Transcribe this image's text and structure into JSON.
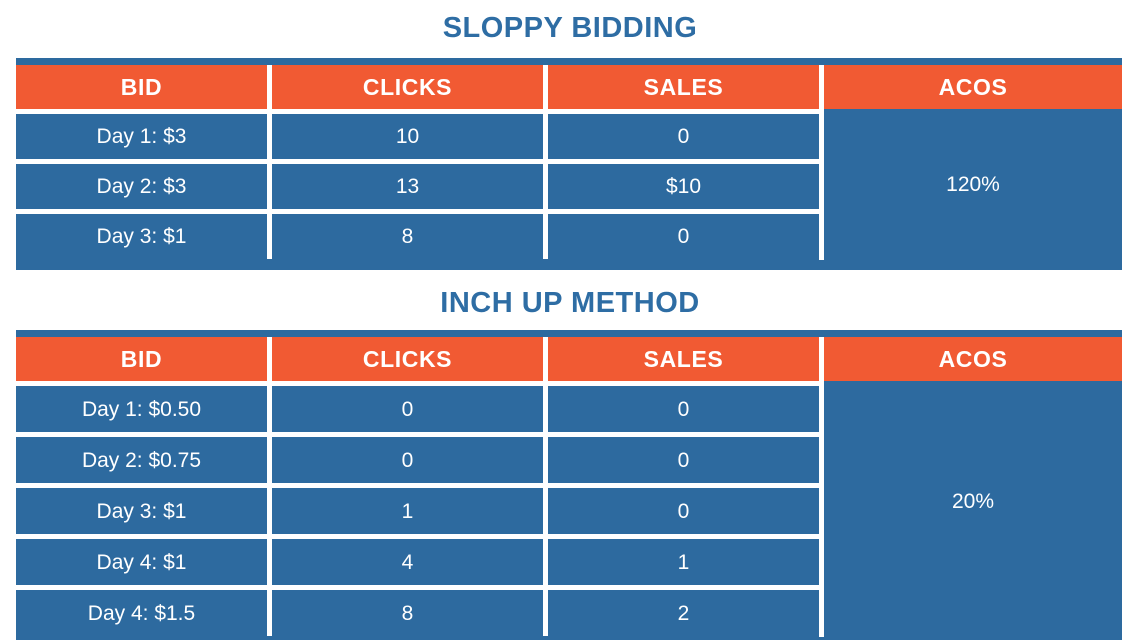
{
  "tables": [
    {
      "title": "SLOPPY BIDDING",
      "columns": [
        "BID",
        "CLICKS",
        "SALES",
        "ACOS"
      ],
      "rows": [
        {
          "bid": "Day 1: $3",
          "clicks": "10",
          "sales": "0"
        },
        {
          "bid": "Day 2: $3",
          "clicks": "13",
          "sales": "$10"
        },
        {
          "bid": "Day 3: $1",
          "clicks": "8",
          "sales": "0"
        }
      ],
      "acos": "120%"
    },
    {
      "title": "INCH UP METHOD",
      "columns": [
        "BID",
        "CLICKS",
        "SALES",
        "ACOS"
      ],
      "rows": [
        {
          "bid": "Day 1: $0.50",
          "clicks": "0",
          "sales": "0"
        },
        {
          "bid": "Day 2: $0.75",
          "clicks": "0",
          "sales": "0"
        },
        {
          "bid": "Day 3: $1",
          "clicks": "1",
          "sales": "0"
        },
        {
          "bid": "Day 4: $1",
          "clicks": "4",
          "sales": "1"
        },
        {
          "bid": "Day 4: $1.5",
          "clicks": "8",
          "sales": "2"
        }
      ],
      "acos": "20%"
    }
  ],
  "colors": {
    "blue": "#2D6A9F",
    "orange": "#F15A33",
    "title_blue": "#2E6DA4",
    "divider": "#FFFFFF",
    "background": "#FFFFFF"
  }
}
